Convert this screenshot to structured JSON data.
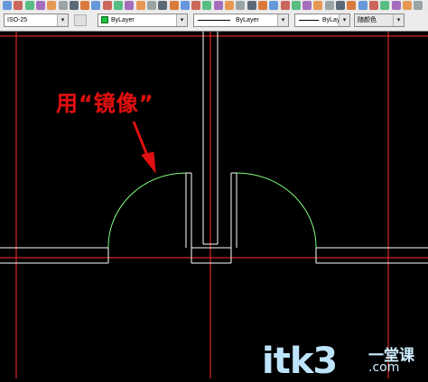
{
  "toolbar": {
    "dimstyle_value": "ISO-25",
    "layer_color_value": "ByLayer",
    "linetype_value": "ByLayer",
    "lineweight_value": "ByLayer",
    "plotstyle_value": "随颜色"
  },
  "annotation": {
    "text": "用“镜像”"
  },
  "watermark": {
    "brand": "itk3",
    "cn_text": "一堂课",
    "domain": ".com"
  },
  "colors": {
    "background": "#000000",
    "wall_lines": "#ffffff",
    "door_arcs": "#7dff7d",
    "axis_lines": "#ff3030",
    "annotation": "#e01010"
  }
}
